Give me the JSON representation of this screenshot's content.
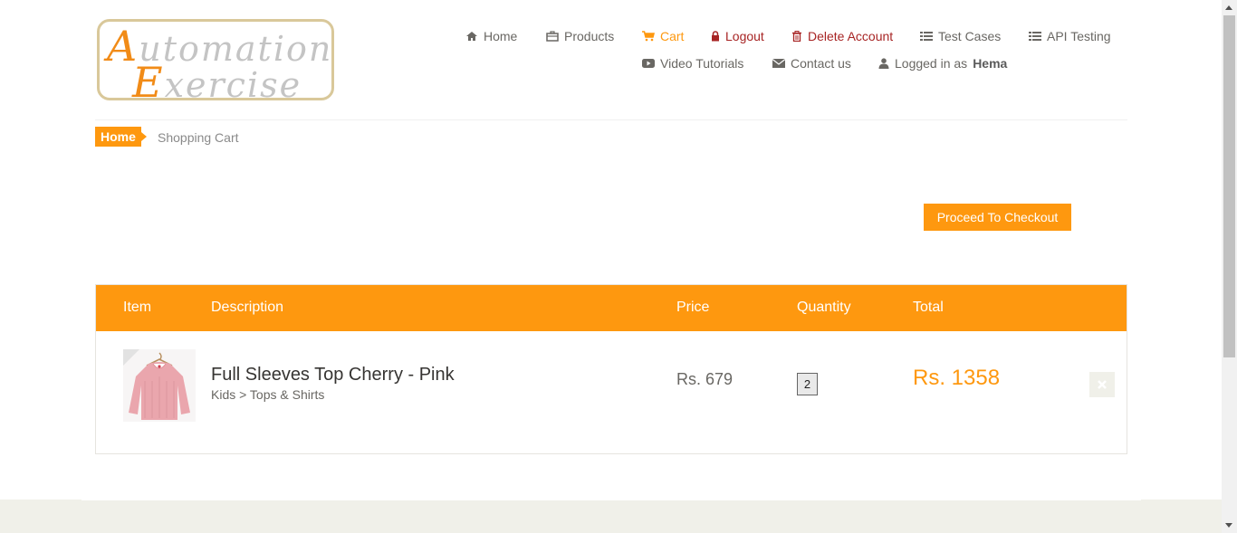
{
  "logo": {
    "line1_cap": "A",
    "line1_rest": "utomation",
    "line2_cap": "E",
    "line2_rest": "xercise"
  },
  "nav": {
    "home": "Home",
    "products": "Products",
    "cart": "Cart",
    "logout": "Logout",
    "delete_account": "Delete Account",
    "test_cases": "Test Cases",
    "api_testing": "API Testing",
    "video_tutorials": "Video Tutorials",
    "contact_us": "Contact us",
    "logged_in_prefix": "Logged in as",
    "username": "Hema"
  },
  "breadcrumb": {
    "home": "Home",
    "current": "Shopping Cart"
  },
  "checkout_label": "Proceed To Checkout",
  "table": {
    "headers": {
      "item": "Item",
      "description": "Description",
      "price": "Price",
      "quantity": "Quantity",
      "total": "Total"
    },
    "rows": [
      {
        "name": "Full Sleeves Top Cherry - Pink",
        "category": "Kids > Tops & Shirts",
        "price": "Rs. 679",
        "quantity": "2",
        "total": "Rs. 1358"
      }
    ]
  },
  "colors": {
    "accent": "#FE980F",
    "danger": "#a72424",
    "text": "#696763"
  }
}
